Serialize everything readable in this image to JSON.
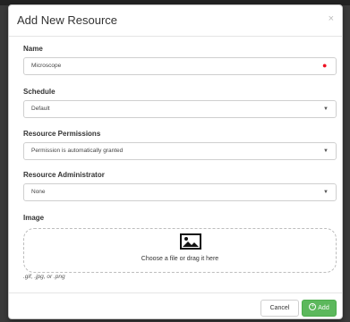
{
  "modal": {
    "title": "Add New Resource",
    "close_glyph": "×"
  },
  "fields": {
    "name": {
      "label": "Name",
      "value": "Microscope",
      "required_marker": "●"
    },
    "schedule": {
      "label": "Schedule",
      "value": "Default"
    },
    "permissions": {
      "label": "Resource Permissions",
      "value": "Permission is automatically granted"
    },
    "administrator": {
      "label": "Resource Administrator",
      "value": "None"
    },
    "image": {
      "label": "Image",
      "dropzone_text": "Choose a file or drag it here",
      "hint": ".gif, .jpg, or .png"
    }
  },
  "footer": {
    "cancel_label": "Cancel",
    "add_label": "Add",
    "add_icon": "plus-circle-icon"
  },
  "icons": {
    "caret": "▼",
    "image": "image-icon"
  },
  "colors": {
    "add_button": "#5cb85c",
    "required": "#ee1122"
  }
}
